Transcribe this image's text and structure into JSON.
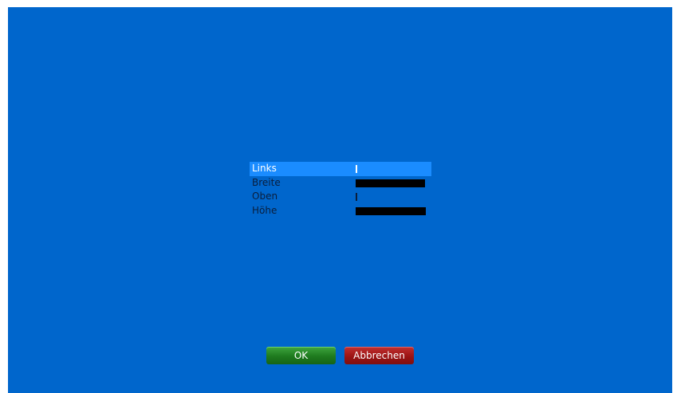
{
  "screen": {
    "background_color": "#0066cc"
  },
  "settings": {
    "items": [
      {
        "label": "Links",
        "selected": true,
        "value_display": "cursor"
      },
      {
        "label": "Breite",
        "selected": false,
        "value_display": "black-bar"
      },
      {
        "label": "Oben",
        "selected": false,
        "value_display": "cursor"
      },
      {
        "label": "Höhe",
        "selected": false,
        "value_display": "black-bar"
      }
    ],
    "selected_color": "#1a8cff"
  },
  "buttons": {
    "ok_label": "OK",
    "ok_color": "#1e7a1e",
    "cancel_label": "Abbrechen",
    "cancel_color": "#9c1414"
  }
}
